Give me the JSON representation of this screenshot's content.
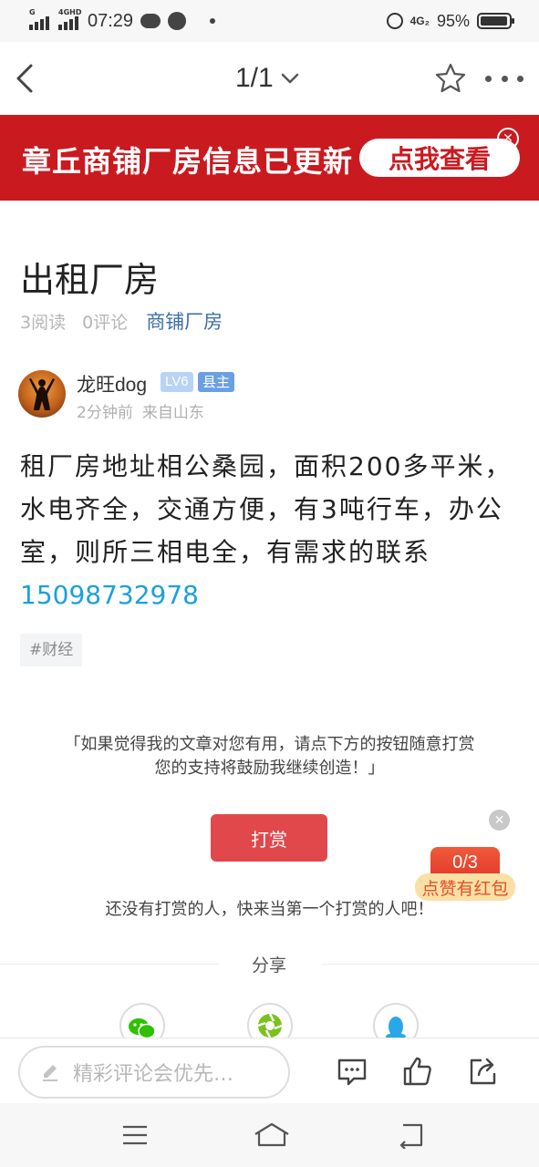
{
  "status_bar": {
    "time": "07:29",
    "signal1_label": "G",
    "signal2_label": "4GHD",
    "network": "4G₂",
    "battery_pct": "95%",
    "battery_level": 0.95
  },
  "nav": {
    "page_indicator": "1/1"
  },
  "banner": {
    "text": "章丘商铺厂房信息已更新",
    "button": "点我查看"
  },
  "article": {
    "title": "出租厂房",
    "reads": "3阅读",
    "comments": "0评论",
    "category": "商铺厂房",
    "author": {
      "name": "龙旺dog",
      "level": "LV6",
      "title_badge": "县主",
      "time": "2分钟前",
      "source": "来自山东"
    },
    "body": "租厂房地址相公桑园，面积200多平米，水电齐全，交通方便，有3吨行车，办公室，则所三相电全，有需求的联系",
    "phone": "15098732978",
    "tag": "#财经"
  },
  "reward": {
    "note_line1": "「如果觉得我的文章对您有用，请点下方的按钮随意打赏",
    "note_line2": "您的支持将鼓励我继续创造！」",
    "button": "打赏",
    "empty_text": "还没有打赏的人，快来当第一个打赏的人吧！"
  },
  "red_packet": {
    "count": "0/3",
    "label": "点赞有红包"
  },
  "share": {
    "label": "分享"
  },
  "comment_bar": {
    "placeholder": "精彩评论会优先…"
  },
  "colors": {
    "banner_red": "#c91a20",
    "link_blue": "#1ca0dc",
    "category_blue": "#3b6fa8",
    "reward_red": "#e0484c"
  }
}
